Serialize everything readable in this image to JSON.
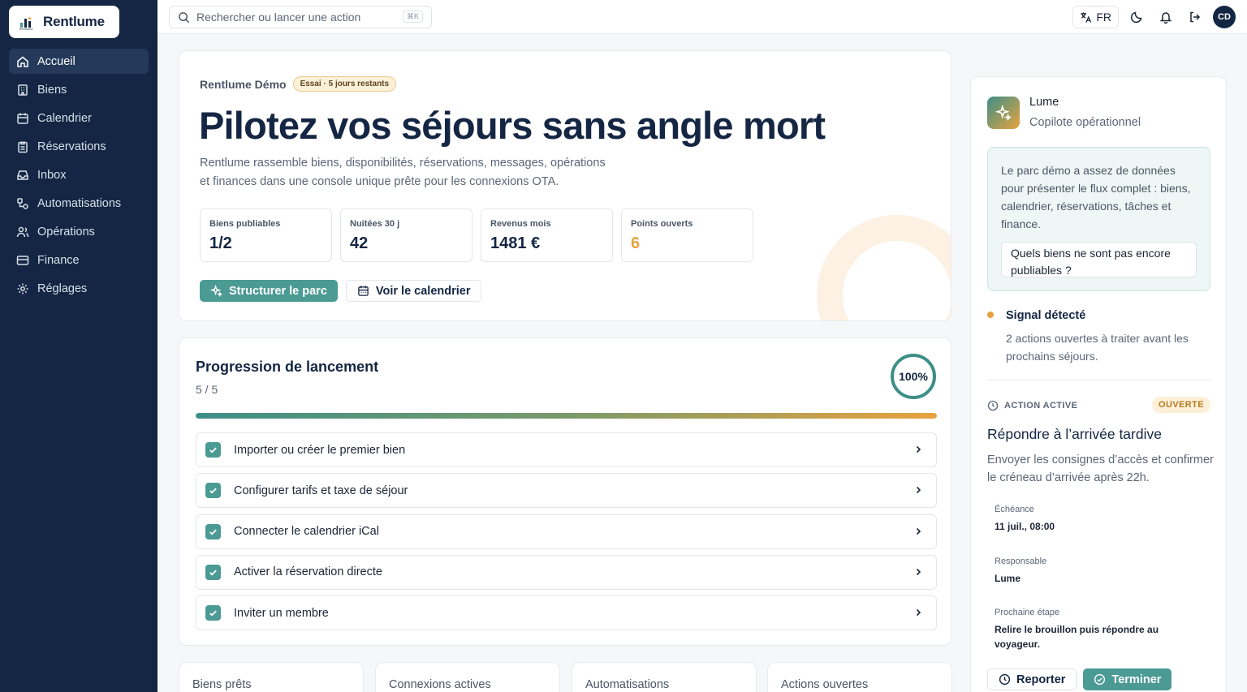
{
  "brand": {
    "name": "Rentlume",
    "mark_caption": "Rentlume"
  },
  "sidebar": {
    "items": [
      {
        "label": "Accueil",
        "icon": "home-icon",
        "active": true
      },
      {
        "label": "Biens",
        "icon": "building-icon"
      },
      {
        "label": "Calendrier",
        "icon": "calendar-icon"
      },
      {
        "label": "Réservations",
        "icon": "clipboard-icon"
      },
      {
        "label": "Inbox",
        "icon": "inbox-icon"
      },
      {
        "label": "Automatisations",
        "icon": "workflow-icon"
      },
      {
        "label": "Opérations",
        "icon": "users-icon"
      },
      {
        "label": "Finance",
        "icon": "credit-card-icon"
      },
      {
        "label": "Réglages",
        "icon": "gear-icon"
      }
    ]
  },
  "topbar": {
    "search_placeholder": "Rechercher ou lancer une action",
    "shortcut": "⌘K",
    "language": "FR",
    "avatar_initials": "CD"
  },
  "hero": {
    "org": "Rentlume Démo",
    "trial_badge": "Essai · 5 jours restants",
    "title": "Pilotez vos séjours sans angle mort",
    "description_line1": "Rentlume rassemble biens, disponibilités, réservations, messages, opérations",
    "description_line2": "et finances dans une console unique prête pour les connexions OTA.",
    "stats": [
      {
        "label": "Biens publiables",
        "value": "1/2"
      },
      {
        "label": "Nuitées 30 j",
        "value": "42"
      },
      {
        "label": "Revenus mois",
        "value": "1481 €"
      },
      {
        "label": "Points ouverts",
        "value": "6"
      }
    ],
    "primary_action": "Structurer le parc",
    "secondary_action": "Voir le calendrier"
  },
  "launch": {
    "title": "Progression de lancement",
    "count": "5 / 5",
    "percent_label": "100%",
    "progress_fraction": 1.0,
    "steps": [
      {
        "label": "Importer ou créer le premier bien",
        "done": true
      },
      {
        "label": "Configurer tarifs et taxe de séjour",
        "done": true
      },
      {
        "label": "Connecter le calendrier iCal",
        "done": true
      },
      {
        "label": "Activer la réservation directe",
        "done": true
      },
      {
        "label": "Inviter un membre",
        "done": true
      }
    ]
  },
  "bottom_cards": [
    "Biens prêts",
    "Connexions actives",
    "Automatisations",
    "Actions ouvertes"
  ],
  "copilot": {
    "name": "Lume",
    "role": "Copilote opérationnel",
    "message": "Le parc démo a assez de données pour présenter le flux complet : biens, calendrier, réservations, tâches et finance.",
    "suggestion": "Quels biens ne sont pas encore publiables ?",
    "signal_title": "Signal détecté",
    "signal_text": "2 actions ouvertes à traiter avant les prochains séjours.",
    "active_label": "ACTION ACTIVE",
    "active_status": "OUVERTE",
    "action_title": "Répondre à l’arrivée tardive",
    "action_desc": "Envoyer les consignes d’accès et confirmer le créneau d’arrivée après 22h.",
    "due_label": "Échéance",
    "due_value": "11 juil., 08:00",
    "owner_label": "Responsable",
    "owner_value": "Lume",
    "next_label": "Prochaine étape",
    "next_value": "Relire le brouillon puis répondre au voyageur.",
    "postpone": "Reporter",
    "finish": "Terminer"
  },
  "colors": {
    "sidebar": "#142643",
    "accent": "#4b9a93",
    "warning": "#e7a33e"
  }
}
